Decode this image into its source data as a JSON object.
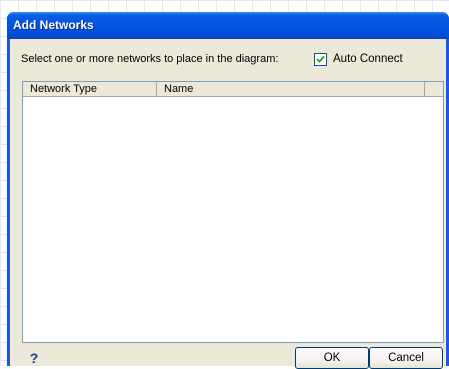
{
  "dialog": {
    "title": "Add Networks",
    "prompt": "Select one or more networks to place in the diagram:",
    "auto_connect": {
      "label": "Auto Connect",
      "checked": true
    }
  },
  "list": {
    "columns": [
      "Network Type",
      "Name"
    ],
    "rows": []
  },
  "buttons": {
    "help_label": "?",
    "ok_label": "OK",
    "cancel_label": "Cancel"
  },
  "colors": {
    "title_bar": "#0454e3",
    "dialog_face": "#ece9d8",
    "list_border": "#7f9db9"
  }
}
